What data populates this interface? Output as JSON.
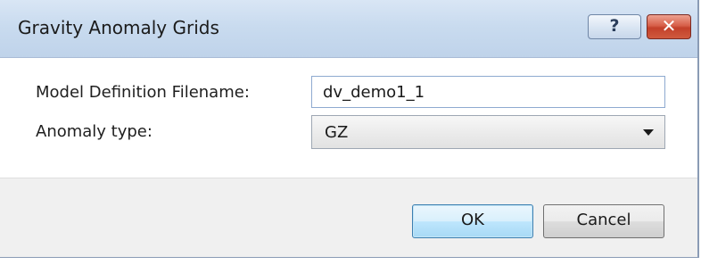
{
  "window": {
    "title": "Gravity Anomaly Grids",
    "help_label": "?",
    "close_label": "✕"
  },
  "form": {
    "filename_label": "Model Definition Filename:",
    "filename_value": "dv_demo1_1",
    "anomaly_label": "Anomaly type:",
    "anomaly_value": "GZ"
  },
  "buttons": {
    "ok_label": "OK",
    "cancel_label": "Cancel"
  },
  "colors": {
    "titlebar": "#c9dbef",
    "close_button": "#c3402a",
    "default_button_border": "#3c7fb1",
    "footer": "#f0f0f0"
  }
}
